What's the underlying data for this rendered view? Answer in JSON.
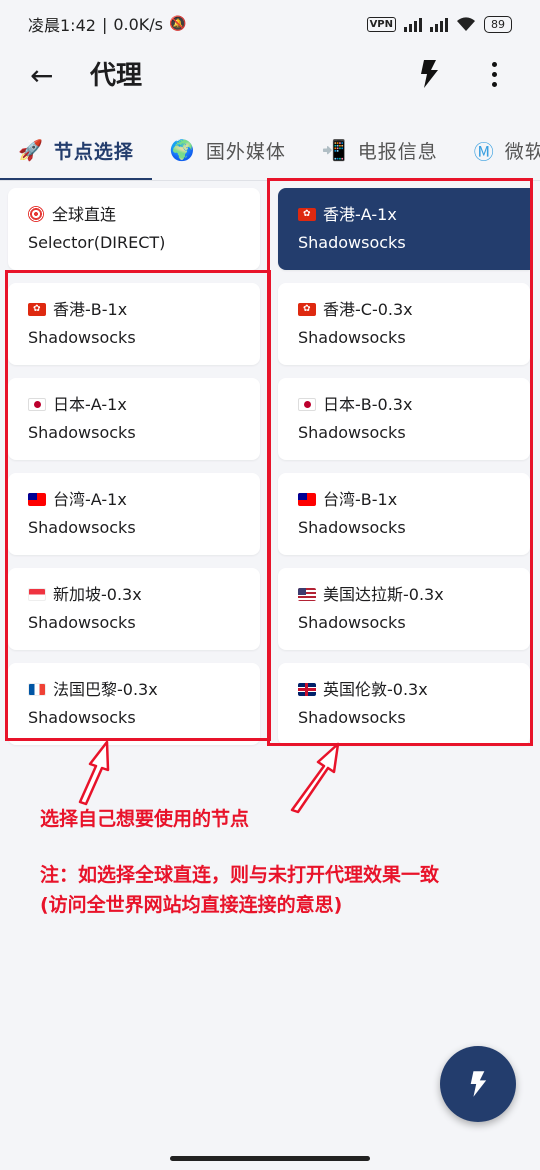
{
  "status_bar": {
    "time": "凌晨1:42",
    "speed": "0.0K/s",
    "vpn": "VPN",
    "battery": "89"
  },
  "app_bar": {
    "back_icon": "arrow-left-icon",
    "title": "代理",
    "bolt_icon": "lightning-icon",
    "more_icon": "more-vert-icon"
  },
  "tabs": [
    {
      "icon": "🚀",
      "label": "节点选择",
      "active": true
    },
    {
      "icon": "🌍",
      "label": "国外媒体",
      "active": false
    },
    {
      "icon": "📲",
      "label": "电报信息",
      "active": false
    },
    {
      "icon": "Ⓜ",
      "label": "微软",
      "active": false
    }
  ],
  "proxies_left": [
    {
      "flag": "target",
      "name": "全球直连",
      "type": "Selector(DIRECT)"
    },
    {
      "flag": "hk",
      "name": "香港-B-1x",
      "type": "Shadowsocks"
    },
    {
      "flag": "jp",
      "name": "日本-A-1x",
      "type": "Shadowsocks"
    },
    {
      "flag": "tw",
      "name": "台湾-A-1x",
      "type": "Shadowsocks"
    },
    {
      "flag": "sg",
      "name": "新加坡-0.3x",
      "type": "Shadowsocks"
    },
    {
      "flag": "fr",
      "name": "法国巴黎-0.3x",
      "type": "Shadowsocks"
    }
  ],
  "proxies_right": [
    {
      "flag": "hk",
      "name": "香港-A-1x",
      "type": "Shadowsocks",
      "selected": true
    },
    {
      "flag": "hk",
      "name": "香港-C-0.3x",
      "type": "Shadowsocks"
    },
    {
      "flag": "jp",
      "name": "日本-B-0.3x",
      "type": "Shadowsocks"
    },
    {
      "flag": "tw",
      "name": "台湾-B-1x",
      "type": "Shadowsocks"
    },
    {
      "flag": "us",
      "name": "美国达拉斯-0.3x",
      "type": "Shadowsocks"
    },
    {
      "flag": "gb",
      "name": "英国伦敦-0.3x",
      "type": "Shadowsocks"
    }
  ],
  "annotations": {
    "line1": "选择自己想要使用的节点",
    "line2": "注：如选择全球直连，则与未打开代理效果一致",
    "line3": "(访问全世界网站均直接连接的意思)"
  },
  "colors": {
    "accent": "#233d6d",
    "annotation_red": "#e8132a",
    "background": "#f4f5f8"
  },
  "fab_icon": "lightning-icon"
}
